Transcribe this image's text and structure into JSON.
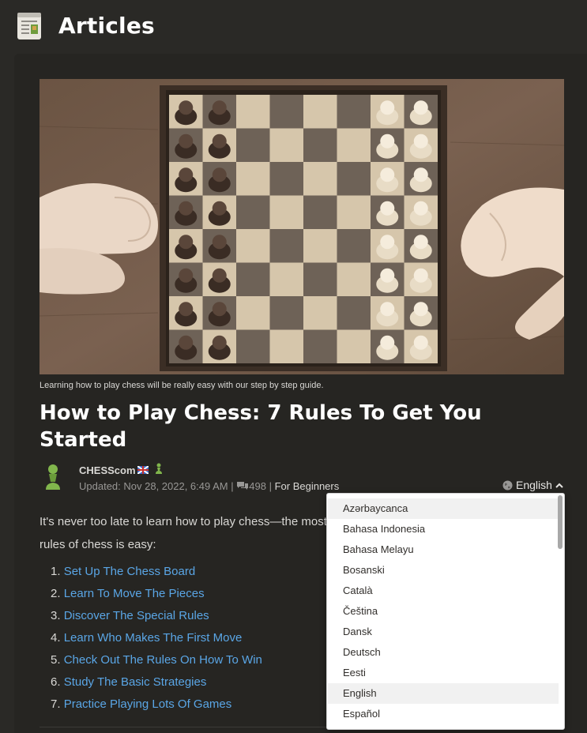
{
  "header": {
    "title": "Articles",
    "icon": "articles-icon"
  },
  "hero": {
    "caption": "Learning how to play chess will be really easy with our step by step guide."
  },
  "article": {
    "title": "How to Play Chess: 7 Rules To Get You Started",
    "author": "CHESScom",
    "author_badges": [
      "flag-icon",
      "pawn-icon"
    ],
    "updated": "Updated: Nov 28, 2022, 6:49 AM |",
    "comment_count": "498",
    "separator": "|",
    "category": "For Beginners",
    "intro_line1": "It's never too late to learn how to play chess—the most",
    "intro_line2": "rules of chess is easy:",
    "toc": [
      {
        "num": "1.",
        "label": "Set Up The Chess Board"
      },
      {
        "num": "2.",
        "label": "Learn To Move The Pieces"
      },
      {
        "num": "3.",
        "label": "Discover The Special Rules"
      },
      {
        "num": "4.",
        "label": "Learn Who Makes The First Move"
      },
      {
        "num": "5.",
        "label": "Check Out The Rules On How To Win"
      },
      {
        "num": "6.",
        "label": "Study The Basic Strategies"
      },
      {
        "num": "7.",
        "label": "Practice Playing Lots Of Games"
      }
    ]
  },
  "language": {
    "current": "English",
    "options": [
      "Azərbaycanca",
      "Bahasa Indonesia",
      "Bahasa Melayu",
      "Bosanski",
      "Català",
      "Čeština",
      "Dansk",
      "Deutsch",
      "Eesti",
      "English",
      "Español"
    ]
  },
  "colors": {
    "background": "#2a2926",
    "panel": "#262522",
    "link": "#5aa6e6",
    "accent_green": "#81b64c"
  }
}
